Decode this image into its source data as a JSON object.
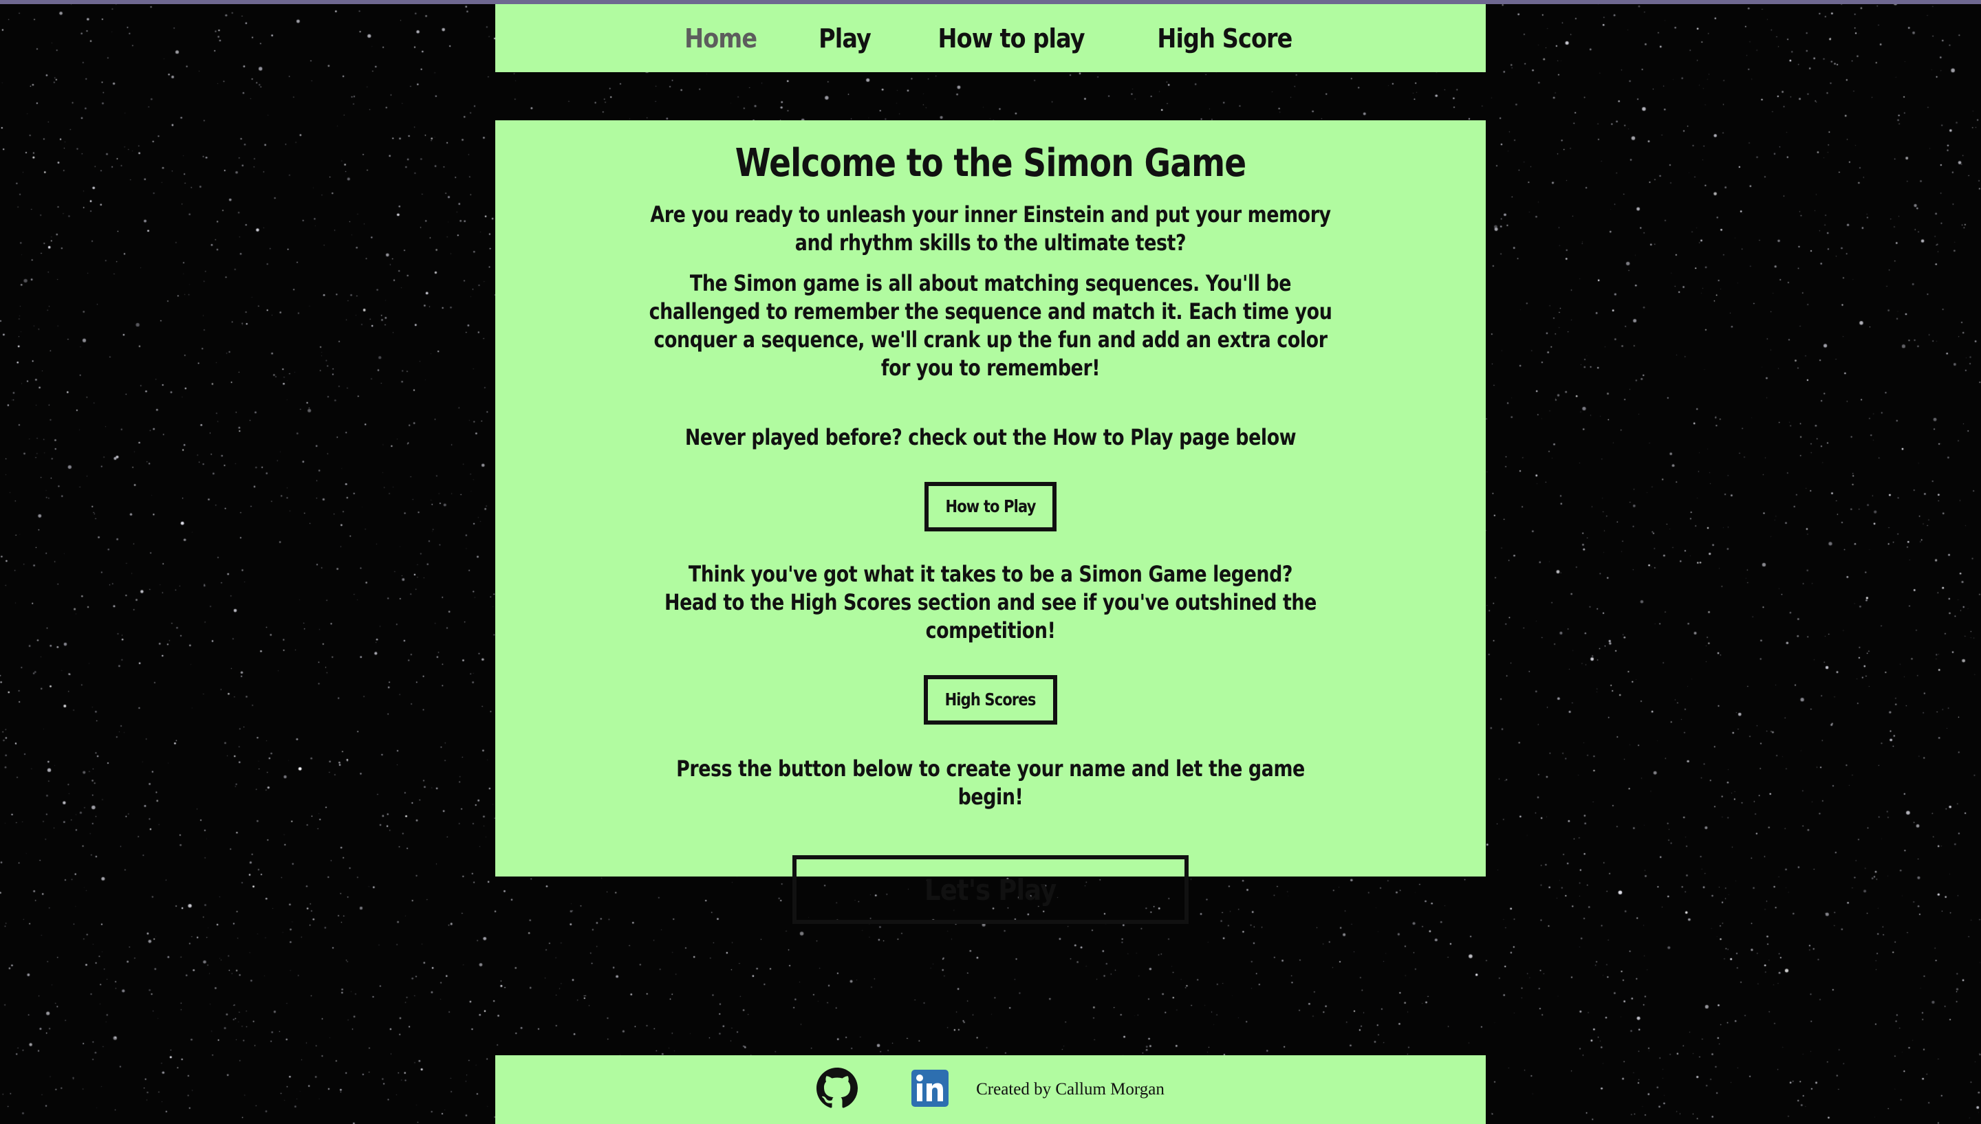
{
  "nav": {
    "items": [
      {
        "label": "Home",
        "active": true
      },
      {
        "label": "Play",
        "active": false
      },
      {
        "label": "How to play",
        "active": false
      },
      {
        "label": "High Score",
        "active": false
      }
    ]
  },
  "main": {
    "title": "Welcome to the Simon Game",
    "intro": "Are you ready to unleash your inner Einstein and put your memory and rhythm skills to the ultimate test?",
    "description": "The Simon game is all about matching sequences. You'll be challenged to remember the sequence and match it. Each time you conquer a sequence, we'll crank up the fun and add an extra color for you to remember!",
    "how_to_prompt": "Never played before? check out the How to Play page below",
    "how_to_button": "How to Play",
    "high_scores_prompt": "Think you've got what it takes to be a Simon Game legend? Head to the High Scores section and see if you've outshined the competition!",
    "high_scores_button": "High Scores",
    "play_prompt": "Press the button below to create your name and let the game begin!",
    "play_button": "Let's Play"
  },
  "footer": {
    "github_icon": "github-icon",
    "linkedin_icon": "linkedin-icon",
    "credit": "Created by Callum Morgan"
  },
  "colors": {
    "panel": "#b1fba0",
    "background": "#050505",
    "text": "#111111",
    "nav_active": "#5d5d5d",
    "linkedin": "#2d6fb0"
  }
}
